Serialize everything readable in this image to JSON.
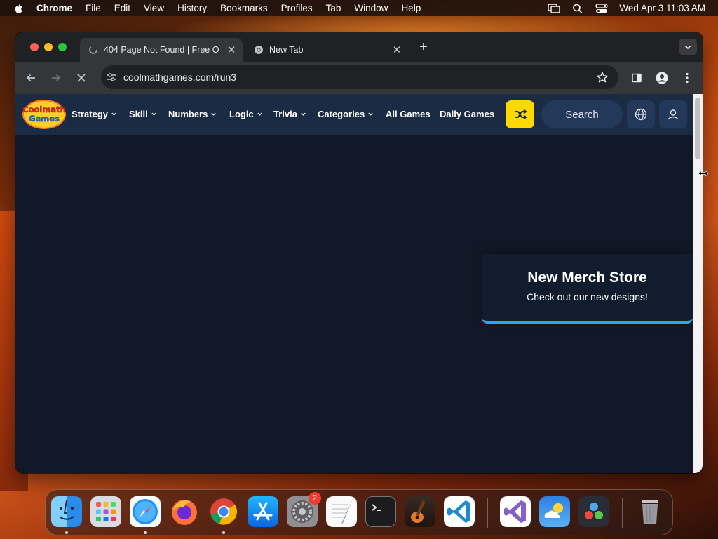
{
  "menubar": {
    "app": "Chrome",
    "items": [
      "File",
      "Edit",
      "View",
      "History",
      "Bookmarks",
      "Profiles",
      "Tab",
      "Window",
      "Help"
    ],
    "clock": "Wed Apr 3  11:03 AM"
  },
  "browser": {
    "tabs": [
      {
        "title": "404 Page Not Found | Free O",
        "active": true
      },
      {
        "title": "New Tab",
        "active": false
      }
    ],
    "url": "coolmathgames.com/run3"
  },
  "site": {
    "logo_text_1": "Coolmath",
    "logo_text_2": "Games",
    "nav": [
      "Strategy",
      "Skill",
      "Numbers",
      "Logic",
      "Trivia",
      "Categories",
      "All Games",
      "Daily Games"
    ],
    "search_label": "Search",
    "accent_yellow": "#ffd800",
    "nav_bg": "#1b2b44"
  },
  "merch": {
    "title": "New Merch Store",
    "subtitle": "Check out our new designs!",
    "accent": "#2aa9e0"
  },
  "dock": {
    "apps": [
      "finder-icon",
      "launchpad-icon",
      "safari-icon",
      "firefox-icon",
      "chrome-icon",
      "app-store-icon",
      "system-settings-icon",
      "textedit-icon",
      "terminal-icon",
      "garageband-icon",
      "vscode-icon",
      "visual-studio-icon",
      "weather-icon",
      "davinci-resolve-icon",
      "trash-icon"
    ],
    "settings_badge": "2"
  }
}
